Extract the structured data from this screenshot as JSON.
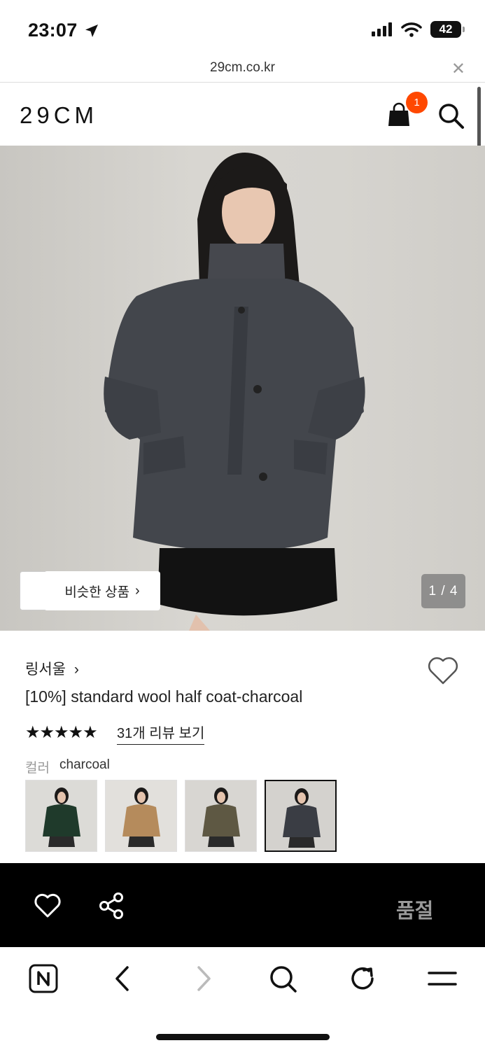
{
  "status_bar": {
    "time": "23:07",
    "battery": "42"
  },
  "browser": {
    "url": "29cm.co.kr",
    "close_icon": "close-icon"
  },
  "header": {
    "logo": "29CM",
    "cart_count": "1"
  },
  "hero": {
    "similar_label": "비슷한 상품",
    "counter": "1 / 4"
  },
  "product": {
    "brand": "링서울",
    "title": "[10%] standard wool half coat-charcoal",
    "stars": "★★★★★",
    "rating": 5,
    "review_link": "31개 리뷰 보기",
    "color_label": "컬러",
    "color_value": "charcoal",
    "swatches": [
      {
        "name": "green",
        "coat": "#1f3a2b"
      },
      {
        "name": "camel",
        "coat": "#b58b5c"
      },
      {
        "name": "khaki",
        "coat": "#5e5843"
      },
      {
        "name": "charcoal",
        "coat": "#3a3d44"
      }
    ]
  },
  "actions": {
    "soldout_label": "품절"
  },
  "colors": {
    "accent": "#ff4800",
    "bar": "#000000",
    "soldout": "#9a9a9a"
  }
}
